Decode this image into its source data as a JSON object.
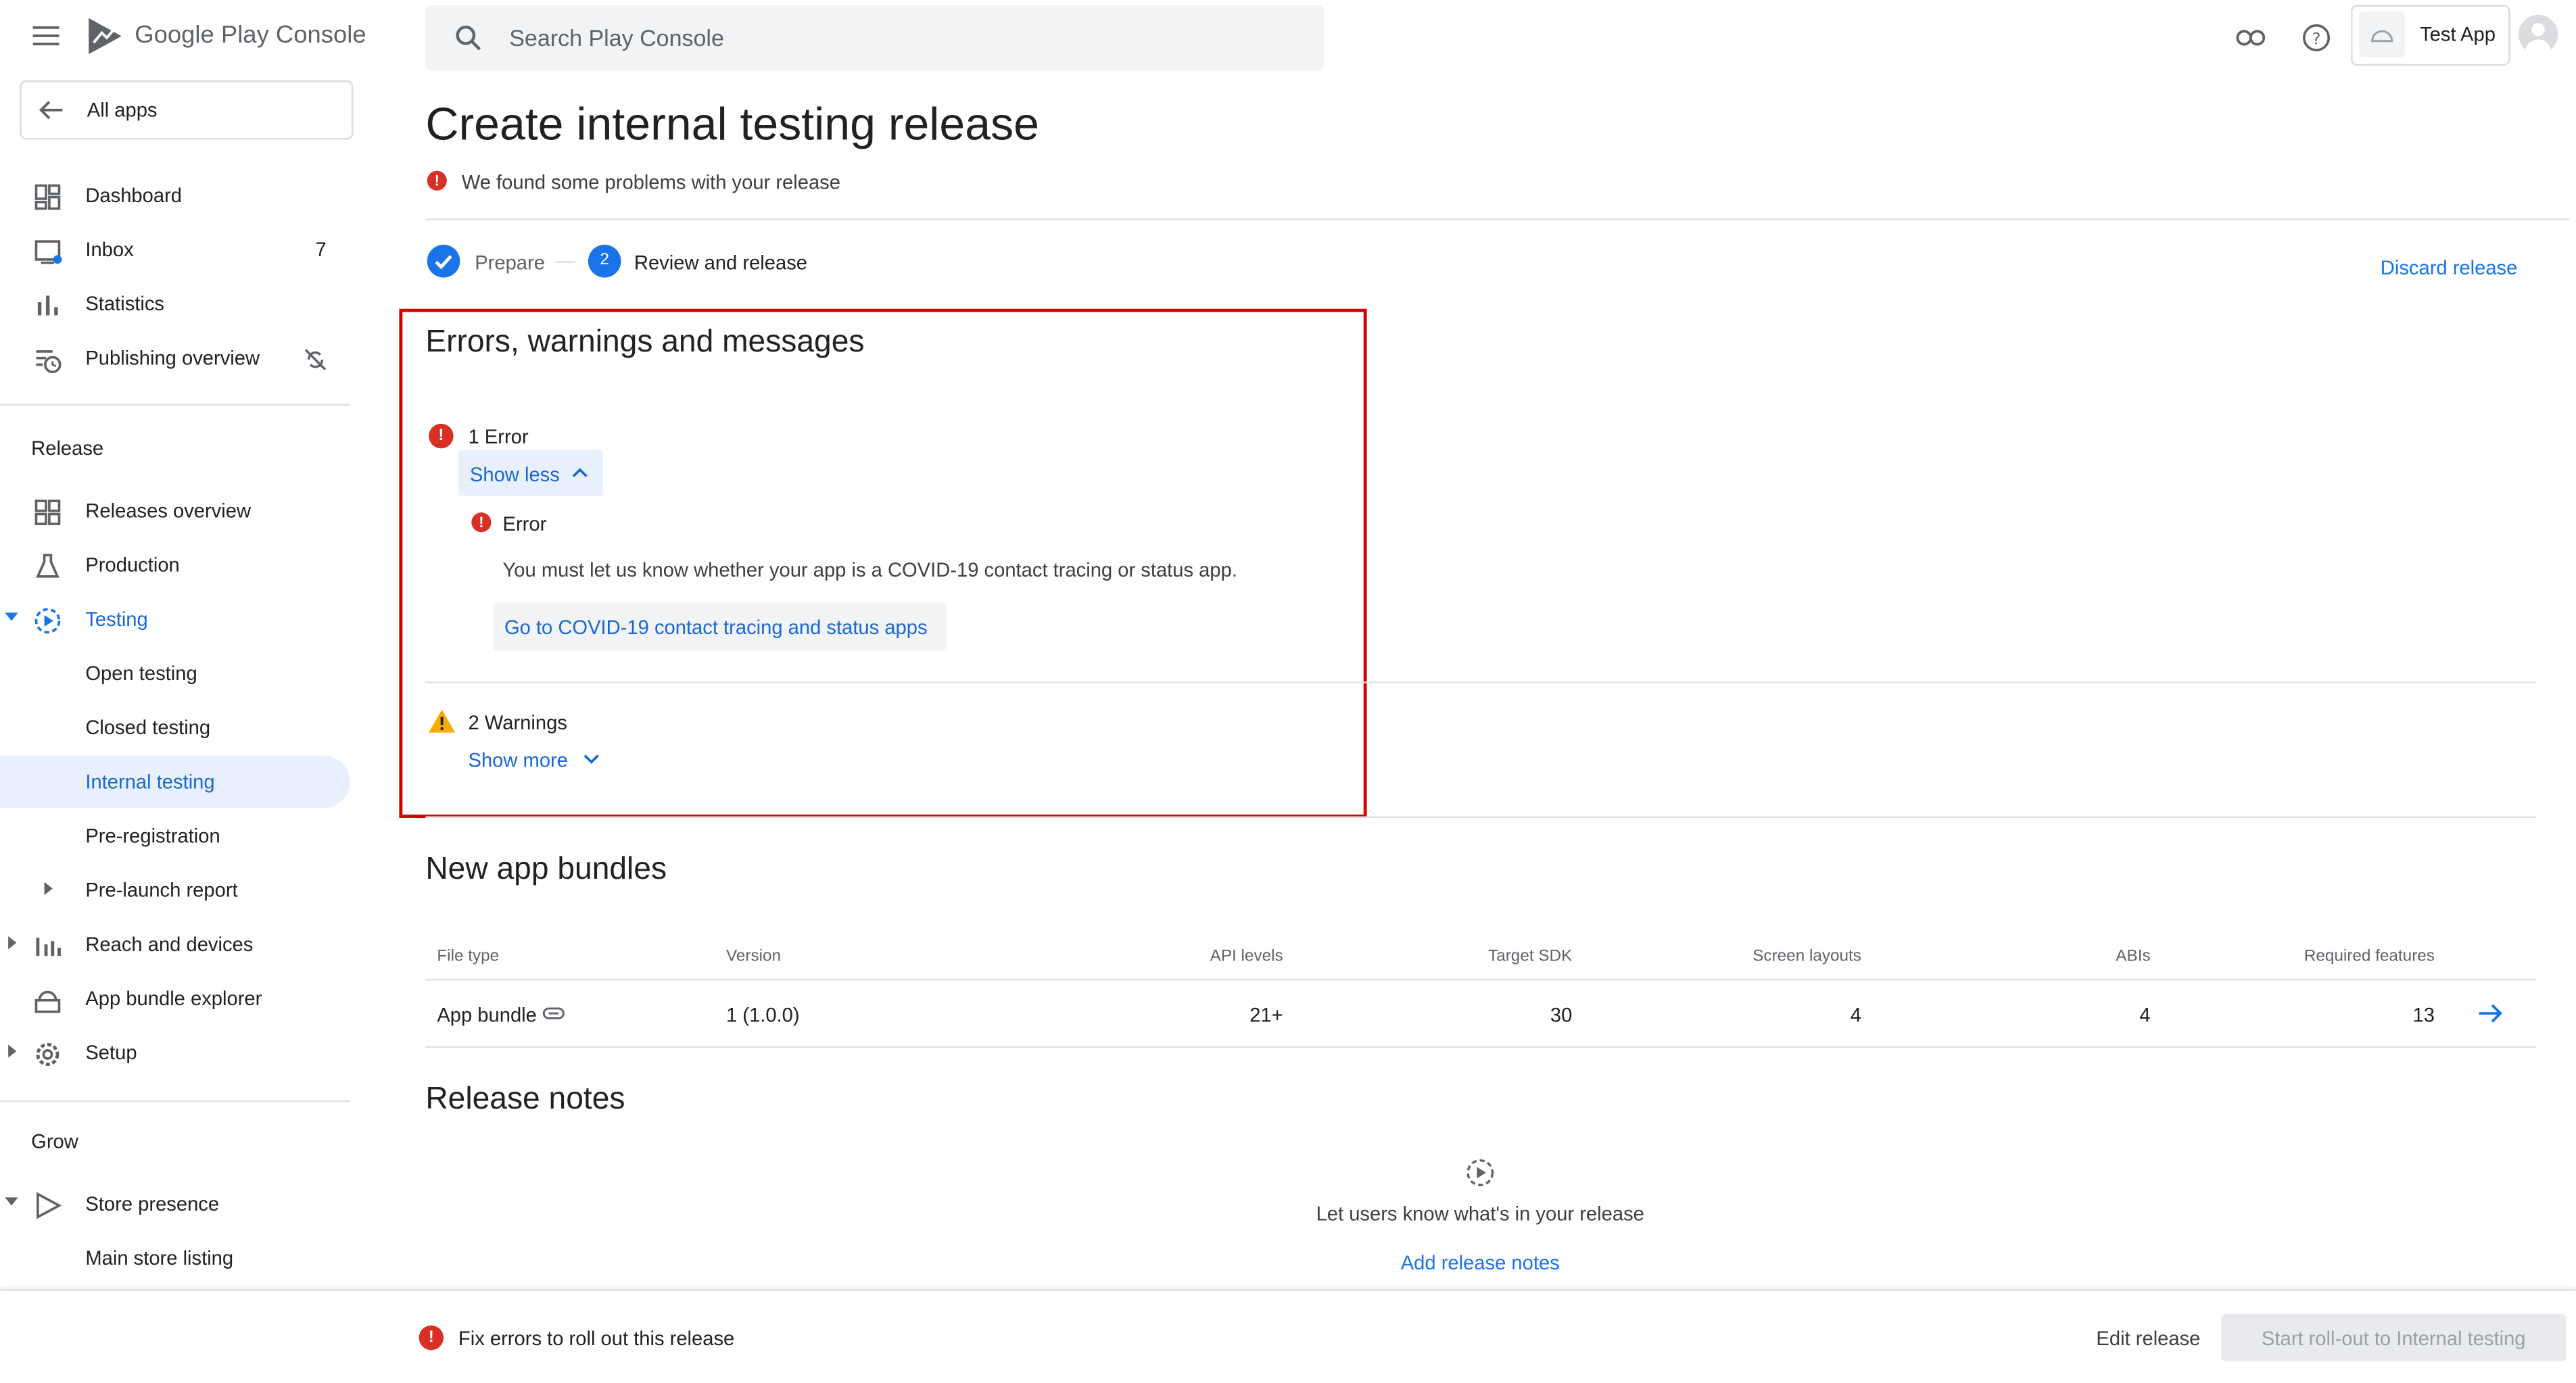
{
  "header": {
    "logo_text": "Google Play Console",
    "search_placeholder": "Search Play Console",
    "app_name": "Test App"
  },
  "sidebar": {
    "all_apps": "All apps",
    "items": [
      {
        "label": "Dashboard",
        "icon": "dashboard-icon"
      },
      {
        "label": "Inbox",
        "icon": "inbox-icon",
        "badge": "7"
      },
      {
        "label": "Statistics",
        "icon": "bar-chart-icon"
      },
      {
        "label": "Publishing overview",
        "icon": "publishing-icon"
      }
    ],
    "release_section": "Release",
    "release_items": [
      {
        "label": "Releases overview",
        "icon": "releases-overview-icon"
      },
      {
        "label": "Production",
        "icon": "production-icon"
      },
      {
        "label": "Testing",
        "icon": "testing-icon"
      },
      {
        "label": "Open testing"
      },
      {
        "label": "Closed testing"
      },
      {
        "label": "Internal testing"
      },
      {
        "label": "Pre-registration"
      },
      {
        "label": "Pre-launch report"
      },
      {
        "label": "Reach and devices",
        "icon": "reach-icon"
      },
      {
        "label": "App bundle explorer",
        "icon": "app-bundle-icon"
      },
      {
        "label": "Setup",
        "icon": "gear-icon"
      }
    ],
    "grow_section": "Grow",
    "grow_items": [
      {
        "label": "Store presence",
        "icon": "store-presence-icon"
      },
      {
        "label": "Main store listing"
      }
    ]
  },
  "page": {
    "title": "Create internal testing release",
    "problem_text": "We found some problems with your release",
    "steps": [
      {
        "label": "Prepare",
        "state": "done"
      },
      {
        "number": "2",
        "label": "Review and release",
        "state": "current"
      }
    ],
    "discard_label": "Discard release"
  },
  "errors_panel": {
    "title": "Errors, warnings and messages",
    "error_count_label": "1 Error",
    "show_less_label": "Show less",
    "error_title": "Error",
    "error_message": "You must let us know whether your app is a COVID-19 contact tracing or status app.",
    "error_link": "Go to COVID-19 contact tracing and status apps",
    "warnings_label": "2 Warnings",
    "show_more_label": "Show more"
  },
  "bundles": {
    "title": "New app bundles",
    "columns": [
      "File type",
      "Version",
      "API levels",
      "Target SDK",
      "Screen layouts",
      "ABIs",
      "Required features"
    ],
    "rows": [
      {
        "file_type": "App bundle",
        "version": "1 (1.0.0)",
        "api_levels": "21+",
        "target_sdk": "30",
        "screen_layouts": "4",
        "abis": "4",
        "required_features": "13"
      }
    ]
  },
  "release_notes": {
    "title": "Release notes",
    "empty_text": "Let users know what's in your release",
    "add_label": "Add release notes"
  },
  "footer": {
    "error_text": "Fix errors to roll out this release",
    "edit_label": "Edit release",
    "rollout_label": "Start roll-out to Internal testing"
  },
  "colors": {
    "accent": "#1a73e8",
    "error": "#d93025",
    "warning": "#f9ab00",
    "highlight_border": "#d50000"
  }
}
